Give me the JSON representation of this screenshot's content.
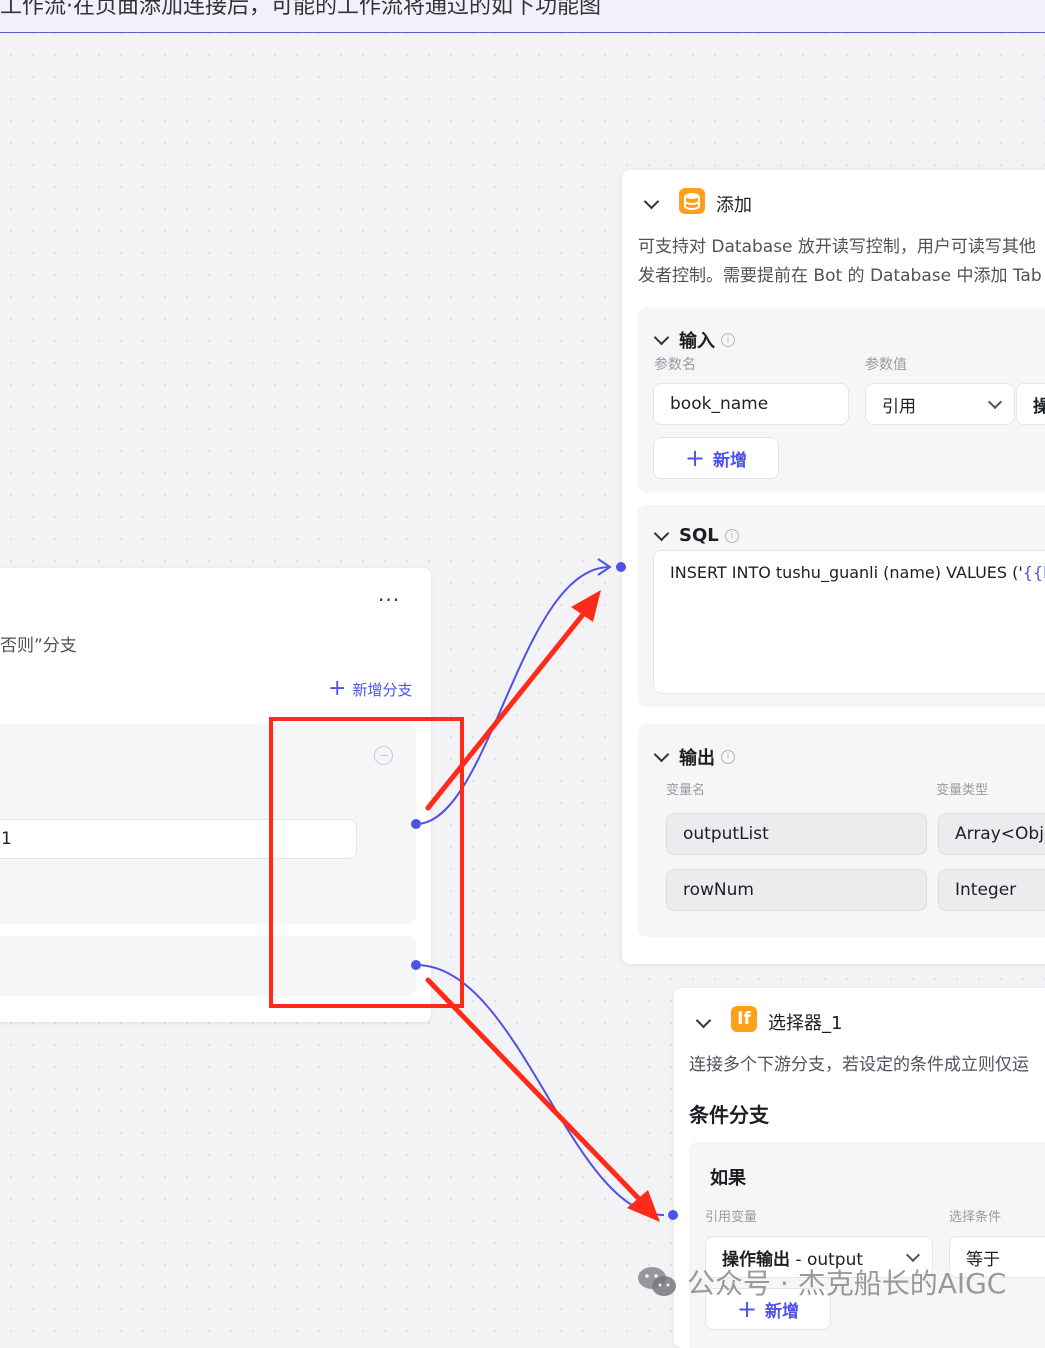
{
  "banner": {
    "text": "工作流·在页面添加连接后，可能的工作流将通过的如下功能图"
  },
  "left_node": {
    "more_label": "···",
    "desc_partial": "否则”分支",
    "add_branch_label": "新增分支",
    "row_value_partial": "1"
  },
  "db_node": {
    "title": "添加",
    "desc_line1": "可支持对 Database 放开读写控制，用户可读写其他",
    "desc_line2": "发者控制。需要提前在 Bot 的 Database 中添加 Tab",
    "input": {
      "title": "输入",
      "col_name": "参数名",
      "col_value": "参数值",
      "param_name": "book_name",
      "param_type": "引用",
      "param_ref_partial": "操",
      "add_label": "新增"
    },
    "sql": {
      "title": "SQL",
      "code_prefix": "INSERT INTO tushu_guanli (name) VALUES ('",
      "code_var_partial": "{{b"
    },
    "output": {
      "title": "输出",
      "col_name": "变量名",
      "col_type": "变量类型",
      "rows": [
        {
          "name": "outputList",
          "type": "Array<Obje"
        },
        {
          "name": "rowNum",
          "type": "Integer"
        }
      ]
    }
  },
  "selector_node": {
    "icon_text": "If",
    "title": "选择器_1",
    "desc": "连接多个下游分支，若设定的条件成立则仅运",
    "branch_title": "条件分支",
    "if_label": "如果",
    "col_ref": "引用变量",
    "col_cond": "选择条件",
    "ref_value_bold": "操作输出",
    "ref_value_rest": " - output",
    "cond_value": "等于",
    "add_label": "新增"
  },
  "watermark": {
    "text": "公众号 · 杰克船长的AIGC"
  },
  "colors": {
    "accent": "#4d53e8",
    "annotation_red": "#ff2a1a",
    "db_icon": "#ff9f1a"
  }
}
